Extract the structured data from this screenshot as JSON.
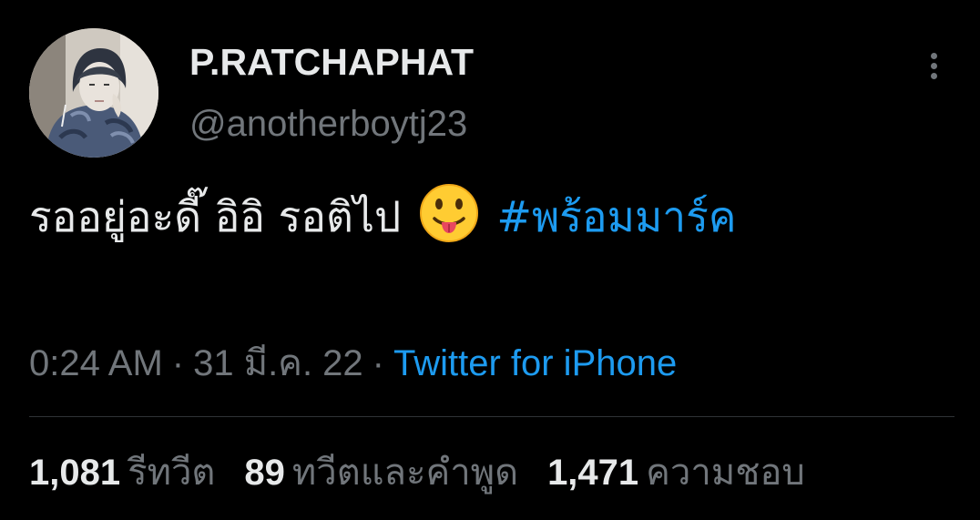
{
  "author": {
    "display_name": "P.RATCHAPHAT",
    "handle": "@anotherboytj23"
  },
  "tweet": {
    "text": "รออยู่อะดี๊ อิอิ รอติไป",
    "emoji": "face-with-tongue-emoji",
    "hashtag": "#พร้อมมาร์ค"
  },
  "meta": {
    "time": "0:24 AM",
    "separator": "·",
    "date": "31 มี.ค. 22",
    "source": "Twitter for iPhone"
  },
  "stats": [
    {
      "count": "1,081",
      "label": "รีทวีต"
    },
    {
      "count": "89",
      "label": "ทวีตและคำพูด"
    },
    {
      "count": "1,471",
      "label": "ความชอบ"
    }
  ],
  "colors": {
    "background": "#000000",
    "primary_text": "#e7e9ea",
    "secondary_text": "#71767b",
    "accent": "#1d9bf0",
    "divider": "#2f3336"
  }
}
